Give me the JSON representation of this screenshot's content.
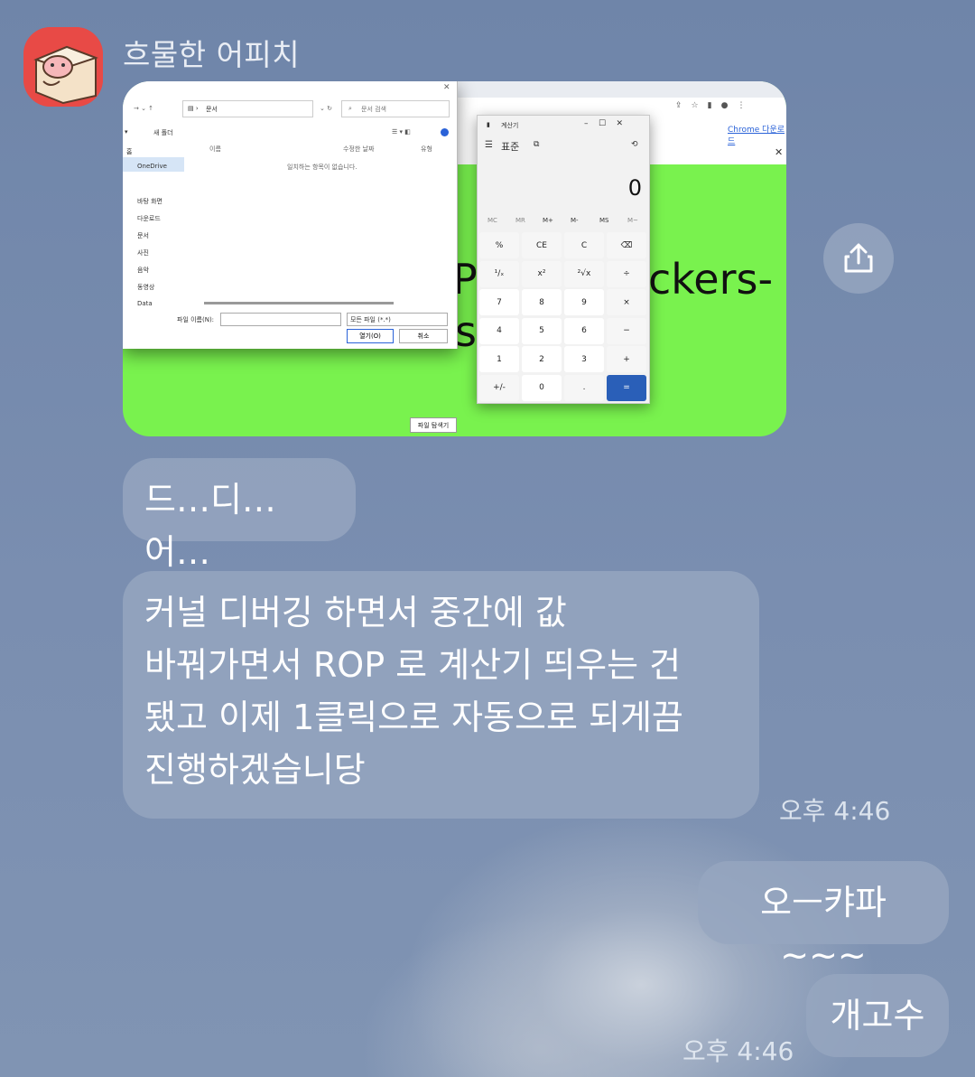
{
  "chat": {
    "sender_name": "흐물한 어피치",
    "messages": [
      {
        "text": "드…디…어…"
      },
      {
        "lines": [
          "커널 디버깅 하면서 중간에 값",
          "바꿔가면서 ROP 로 계산기 띄우는 건",
          "됐고 이제 1클릭으로 자동으로 되게끔",
          "진행하겠습니당"
        ]
      }
    ],
    "received_time": "오후 4:46",
    "sent_messages": [
      "오ㅡ캬파~~~",
      "개고수"
    ],
    "sent_time": "오후 4:46"
  },
  "screenshot": {
    "explorer": {
      "path_label": "문서",
      "search_placeholder": "문서 검색",
      "new_folder": "새 폴더",
      "col_name": "이름",
      "col_date": "수정한 날짜",
      "col_type": "유형",
      "empty_message": "일치하는 항목이 없습니다.",
      "nav_items": [
        "홈",
        "OneDrive",
        "바탕 화면",
        "다운로드",
        "문서",
        "사진",
        "음악",
        "동영상",
        "Data"
      ],
      "filename_label": "파일 이름(N):",
      "filetype_value": "모든 파일 (*.*)",
      "open_button": "열기(O)",
      "cancel_button": "취소"
    },
    "calculator": {
      "title": "계산기",
      "mode": "표준",
      "display": "0",
      "memory_keys": [
        "MC",
        "MR",
        "M+",
        "M-",
        "MS",
        "M~"
      ],
      "keys": [
        [
          "%",
          "CE",
          "C",
          "⌫"
        ],
        [
          "¹/ₓ",
          "x²",
          "²√x",
          "÷"
        ],
        [
          "7",
          "8",
          "9",
          "×"
        ],
        [
          "4",
          "5",
          "6",
          "−"
        ],
        [
          "1",
          "2",
          "3",
          "+"
        ],
        [
          "+/-",
          "0",
          ".",
          "="
        ]
      ]
    },
    "chrome_link": "Chrome 다운로드",
    "page_text_right": "ckers-",
    "page_text_left_1": "P",
    "page_text_left_2": "st",
    "browse_button": "파일 탐색기"
  },
  "icons": {
    "share": "share-icon"
  },
  "colors": {
    "bubble": "#96a6c0",
    "avatar_bg": "#e84a46",
    "page_green": "#79f24e",
    "calc_equals": "#2a5fb8"
  }
}
